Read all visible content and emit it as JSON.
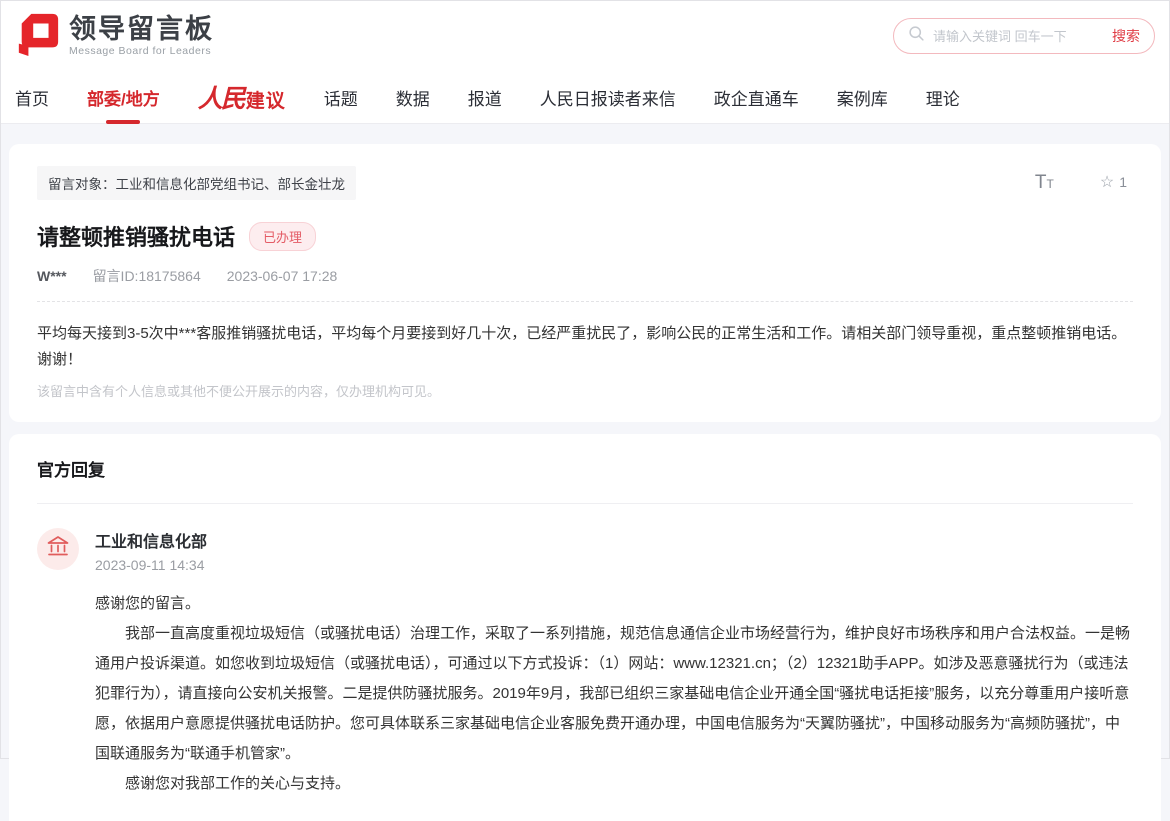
{
  "header": {
    "logo_title": "领导留言板",
    "logo_subtitle": "Message Board for Leaders",
    "search": {
      "placeholder": "请输入关键词 回车一下",
      "button": "搜索"
    }
  },
  "nav": {
    "items": [
      {
        "label": "首页"
      },
      {
        "label": "部委/地方"
      },
      {
        "label": "人民",
        "label2": "建议"
      },
      {
        "label": "话题"
      },
      {
        "label": "数据"
      },
      {
        "label": "报道"
      },
      {
        "label": "人民日报读者来信"
      },
      {
        "label": "政企直通车"
      },
      {
        "label": "案例库"
      },
      {
        "label": "理论"
      }
    ]
  },
  "message": {
    "target_label": "留言对象：工业和信息化部党组书记、部长金壮龙",
    "title": "请整顿推销骚扰电话",
    "status_badge": "已办理",
    "author": "W***",
    "message_id": "留言ID:18175864",
    "datetime": "2023-06-07 17:28",
    "body": "平均每天接到3-5次中***客服推销骚扰电话，平均每个月要接到好几十次，已经严重扰民了，影响公民的正常生活和工作。请相关部门领导重视，重点整顿推销电话。谢谢！",
    "privacy_note": "该留言中含有个人信息或其他不便公开展示的内容，仅办理机构可见。",
    "favorite_count": "1",
    "font_size_icon_big": "T",
    "font_size_icon_small": "T"
  },
  "reply": {
    "section_title": "官方回复",
    "agency": "工业和信息化部",
    "datetime": "2023-09-11 14:34",
    "paragraphs": [
      "感谢您的留言。",
      "我部一直高度重视垃圾短信（或骚扰电话）治理工作，采取了一系列措施，规范信息通信企业市场经营行为，维护良好市场秩序和用户合法权益。一是畅通用户投诉渠道。如您收到垃圾短信（或骚扰电话），可通过以下方式投诉：（1）网站：www.12321.cn；（2）12321助手APP。如涉及恶意骚扰行为（或违法犯罪行为），请直接向公安机关报警。二是提供防骚扰服务。2019年9月，我部已组织三家基础电信企业开通全国“骚扰电话拒接”服务，以充分尊重用户接听意愿，依据用户意愿提供骚扰电话防护。您可具体联系三家基础电信企业客服免费开通办理，中国电信服务为“天翼防骚扰”，中国移动服务为“高频防骚扰”，中国联通服务为“联通手机管家”。",
      "感谢您对我部工作的关心与支持。"
    ]
  },
  "colors": {
    "accent_red": "#d5282d",
    "logo_red": "#e5252a",
    "badge_text": "#e45c66",
    "badge_bg": "#fdedef",
    "search_border": "#f3b9be",
    "band_bg": "#f5f6fa"
  }
}
